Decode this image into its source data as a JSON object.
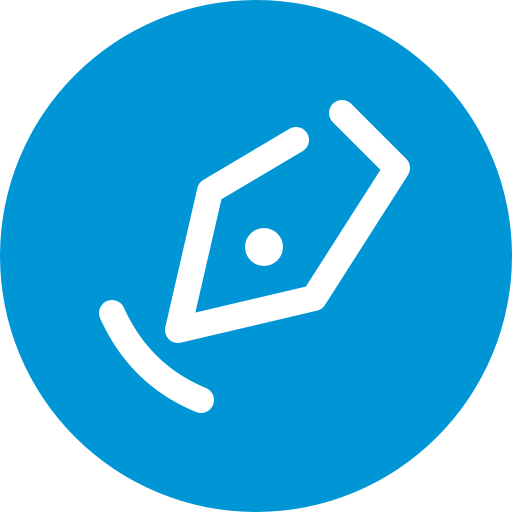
{
  "icon": {
    "name": "pen-tool-icon",
    "colors": {
      "background": "#0096D6",
      "foreground": "#FFFFFF"
    }
  }
}
